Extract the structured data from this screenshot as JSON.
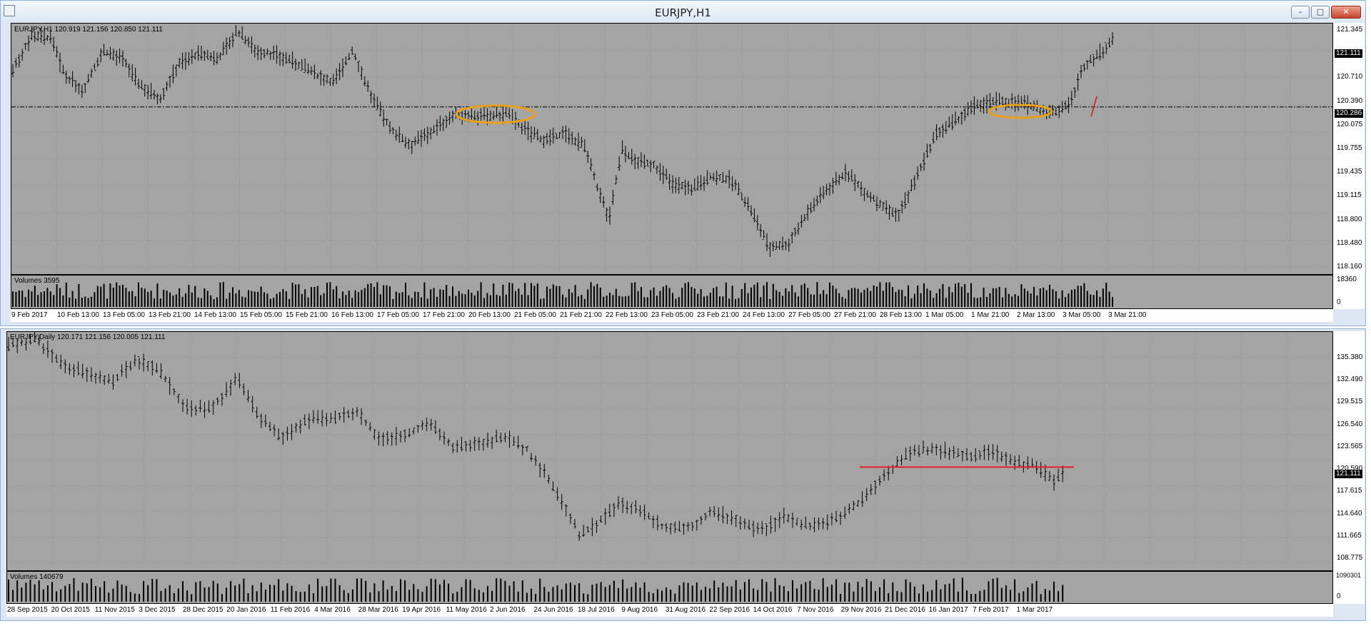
{
  "window": {
    "title": "EURJPY,H1"
  },
  "top_chart": {
    "header": "EURJPY,H1  120.919 121.156 120.850 121.111",
    "volume_header": "Volumes 3595",
    "y_ticks": [
      "121.345",
      "121.030",
      "120.710",
      "120.390",
      "120.075",
      "119.755",
      "119.435",
      "119.115",
      "118.800",
      "118.480",
      "118.160"
    ],
    "price_tag": "121.111",
    "level_tag": "120.286",
    "volume_ticks": [
      "18360",
      "0"
    ],
    "x_labels": [
      "9 Feb 2017",
      "10 Feb 13:00",
      "13 Feb 05:00",
      "13 Feb 21:00",
      "14 Feb 13:00",
      "15 Feb 05:00",
      "15 Feb 21:00",
      "16 Feb 13:00",
      "17 Feb 05:00",
      "17 Feb 21:00",
      "20 Feb 13:00",
      "21 Feb 05:00",
      "21 Feb 21:00",
      "22 Feb 13:00",
      "23 Feb 05:00",
      "23 Feb 21:00",
      "24 Feb 13:00",
      "27 Feb 05:00",
      "27 Feb 21:00",
      "28 Feb 13:00",
      "1 Mar 05:00",
      "1 Mar 21:00",
      "2 Mar 13:00",
      "3 Mar 05:00",
      "3 Mar 21:00"
    ],
    "ylim": [
      118.16,
      121.345
    ]
  },
  "bottom_chart": {
    "header": "EURJPY,Daily  120.171 121.156 120.005 121.111",
    "volume_header": "Volumes 140679",
    "y_ticks": [
      "135.380",
      "132.490",
      "129.515",
      "126.540",
      "123.565",
      "120.590",
      "117.615",
      "114.640",
      "111.665",
      "108.775"
    ],
    "price_tag": "121.111",
    "volume_ticks": [
      "1090301",
      "0"
    ],
    "x_labels": [
      "28 Sep 2015",
      "20 Oct 2015",
      "11 Nov 2015",
      "3 Dec 2015",
      "28 Dec 2015",
      "20 Jan 2016",
      "11 Feb 2016",
      "4 Mar 2016",
      "28 Mar 2016",
      "19 Apr 2016",
      "11 May 2016",
      "2 Jun 2016",
      "24 Jun 2016",
      "18 Jul 2016",
      "9 Aug 2016",
      "31 Aug 2016",
      "22 Sep 2016",
      "14 Oct 2016",
      "7 Nov 2016",
      "29 Nov 2016",
      "21 Dec 2016",
      "16 Jan 2017",
      "7 Feb 2017",
      "1 Mar 2017"
    ],
    "ylim": [
      108.775,
      137.0
    ]
  },
  "chart_data": [
    {
      "type": "ohlc",
      "title": "EURJPY,H1",
      "ylim": [
        118.16,
        121.345
      ],
      "horizontal_level": 120.286,
      "price_path": [
        [
          0,
          120.75
        ],
        [
          3,
          121.2
        ],
        [
          6,
          121.15
        ],
        [
          8,
          120.7
        ],
        [
          11,
          120.5
        ],
        [
          14,
          121.0
        ],
        [
          17,
          120.9
        ],
        [
          20,
          120.55
        ],
        [
          23,
          120.4
        ],
        [
          26,
          120.85
        ],
        [
          29,
          120.95
        ],
        [
          32,
          120.9
        ],
        [
          35,
          121.25
        ],
        [
          38,
          121.0
        ],
        [
          41,
          120.95
        ],
        [
          44,
          120.85
        ],
        [
          47,
          120.7
        ],
        [
          50,
          120.6
        ],
        [
          53,
          121.0
        ],
        [
          56,
          120.4
        ],
        [
          59,
          120.0
        ],
        [
          62,
          119.8
        ],
        [
          65,
          119.95
        ],
        [
          68,
          120.15
        ],
        [
          71,
          120.2
        ],
        [
          74,
          120.15
        ],
        [
          77,
          120.2
        ],
        [
          80,
          120.0
        ],
        [
          83,
          119.85
        ],
        [
          86,
          119.95
        ],
        [
          89,
          119.8
        ],
        [
          91,
          119.3
        ],
        [
          93,
          118.85
        ],
        [
          95,
          119.75
        ],
        [
          97,
          119.6
        ],
        [
          100,
          119.55
        ],
        [
          103,
          119.3
        ],
        [
          106,
          119.25
        ],
        [
          109,
          119.4
        ],
        [
          112,
          119.35
        ],
        [
          115,
          119.0
        ],
        [
          118,
          118.5
        ],
        [
          121,
          118.55
        ],
        [
          124,
          118.95
        ],
        [
          127,
          119.25
        ],
        [
          130,
          119.45
        ],
        [
          133,
          119.2
        ],
        [
          136,
          119.0
        ],
        [
          138,
          118.9
        ],
        [
          141,
          119.4
        ],
        [
          144,
          119.95
        ],
        [
          147,
          120.1
        ],
        [
          150,
          120.3
        ],
        [
          153,
          120.35
        ],
        [
          156,
          120.35
        ],
        [
          159,
          120.3
        ],
        [
          162,
          120.2
        ],
        [
          165,
          120.35
        ],
        [
          167,
          120.8
        ],
        [
          170,
          121.0
        ],
        [
          172,
          121.2
        ]
      ]
    },
    {
      "type": "ohlc",
      "title": "EURJPY,Daily",
      "ylim": [
        108.775,
        137.0
      ],
      "horizontal_level": 121.0,
      "price_path": [
        [
          0,
          135.3
        ],
        [
          6,
          136.3
        ],
        [
          12,
          133.3
        ],
        [
          18,
          132.0
        ],
        [
          24,
          131.0
        ],
        [
          29,
          133.8
        ],
        [
          34,
          132.7
        ],
        [
          40,
          128.2
        ],
        [
          46,
          127.8
        ],
        [
          52,
          131.5
        ],
        [
          57,
          127.0
        ],
        [
          62,
          124.5
        ],
        [
          68,
          126.6
        ],
        [
          74,
          126.6
        ],
        [
          79,
          127.8
        ],
        [
          84,
          124.5
        ],
        [
          90,
          124.8
        ],
        [
          96,
          126.1
        ],
        [
          101,
          123.4
        ],
        [
          107,
          123.8
        ],
        [
          113,
          124.6
        ],
        [
          118,
          123.1
        ],
        [
          123,
          119.5
        ],
        [
          127,
          116.0
        ],
        [
          130,
          113.0
        ],
        [
          134,
          114.3
        ],
        [
          139,
          116.7
        ],
        [
          144,
          116.0
        ],
        [
          149,
          113.9
        ],
        [
          155,
          113.8
        ],
        [
          160,
          115.6
        ],
        [
          166,
          114.8
        ],
        [
          171,
          113.4
        ],
        [
          177,
          115.2
        ],
        [
          182,
          114.0
        ],
        [
          188,
          114.7
        ],
        [
          193,
          116.5
        ],
        [
          199,
          119.8
        ],
        [
          204,
          122.3
        ],
        [
          209,
          123.1
        ],
        [
          214,
          123.0
        ],
        [
          219,
          122.2
        ],
        [
          224,
          122.9
        ],
        [
          229,
          121.5
        ],
        [
          234,
          121.2
        ],
        [
          238,
          119.3
        ],
        [
          241,
          120.7
        ]
      ]
    }
  ]
}
